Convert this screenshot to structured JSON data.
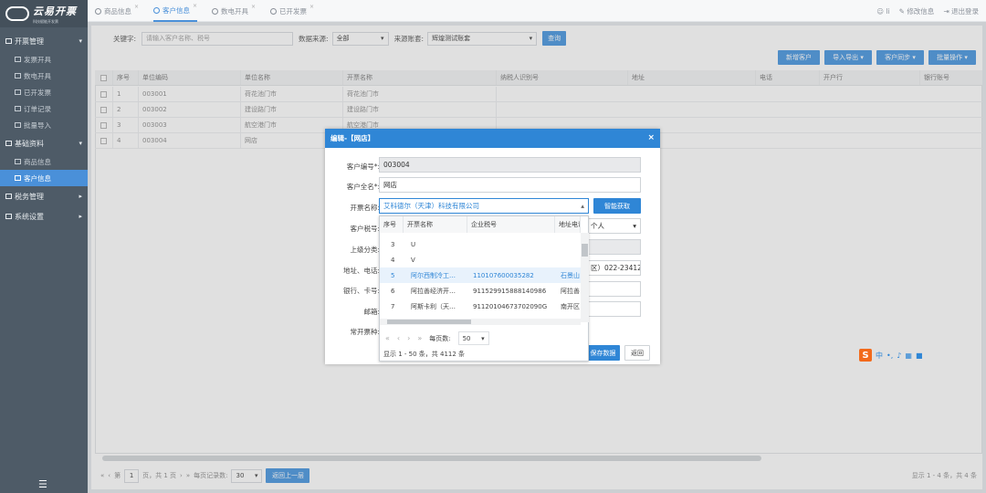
{
  "app": {
    "logo_title": "云易开票",
    "logo_subtitle": "科技赋能开发票"
  },
  "sidebar": {
    "groups": [
      {
        "label": "开票管理",
        "items": [
          "发票开具",
          "数电开具",
          "已开发票",
          "订单记录",
          "批量导入"
        ]
      },
      {
        "label": "基础资料",
        "items": [
          "商品信息",
          "客户信息"
        ]
      },
      {
        "label": "税务管理",
        "items": []
      },
      {
        "label": "系统设置",
        "items": []
      }
    ],
    "active_item": "客户信息"
  },
  "tabs": [
    {
      "label": "商品信息"
    },
    {
      "label": "客户信息"
    },
    {
      "label": "数电开具"
    },
    {
      "label": "已开发票"
    }
  ],
  "header": {
    "user": "li",
    "change_info": "修改信息",
    "logout": "退出登录"
  },
  "search": {
    "keyword_label": "关键字:",
    "keyword_placeholder": "请输入客户名称、税号",
    "source_label": "数据来源:",
    "source_value": "全部",
    "account_label": "来源账套:",
    "account_value": "辉煌测试账套",
    "query_button": "查询"
  },
  "toolbar": {
    "add": "新增客户",
    "import_export": "导入导出 ▾",
    "sync": "客户同步 ▾",
    "batch": "批量操作 ▾"
  },
  "table": {
    "headers": [
      "序号",
      "单位编码",
      "单位名称",
      "开票名称",
      "纳税人识别号",
      "地址",
      "电话",
      "开户行",
      "银行账号"
    ],
    "rows": [
      [
        "1",
        "003001",
        "荷花池门市",
        "荷花池门市"
      ],
      [
        "2",
        "003002",
        "建设路门市",
        "建设路门市"
      ],
      [
        "3",
        "003003",
        "航空港门市",
        "航空港门市"
      ],
      [
        "4",
        "003004",
        "网店",
        ""
      ]
    ]
  },
  "pager": {
    "page_prefix": "第",
    "page": "1",
    "page_suffix": "页，共 1 页",
    "per_page_label": "每页记录数:",
    "per_page": "30",
    "back_button": "返回上一层",
    "summary": "显示 1 - 4 条，共 4 条"
  },
  "dialog": {
    "title": "编辑-【网店】",
    "labels": {
      "code": "客户编号*:",
      "fullname": "客户全名*:",
      "invoice_name": "开票名称:",
      "tax_no": "客户税号:",
      "parent": "上级分类:",
      "address": "地址、电话:",
      "bank": "银行、卡号:",
      "email": "邮箱:",
      "common_type": "常开票种:"
    },
    "values": {
      "code": "003004",
      "fullname": "网店",
      "invoice_name": "艾科德尔（天津）科技有限公司",
      "tax_type": "个人",
      "address_tail": "区）022-23412"
    },
    "smart_button": "智能获取",
    "save_button": "保存数据",
    "back_button": "返回"
  },
  "dropdown": {
    "headers": [
      "序号",
      "开票名称",
      "企业税号",
      "地址电话"
    ],
    "rows": [
      {
        "no": "3",
        "name": "U",
        "tax": "",
        "addr": ""
      },
      {
        "no": "4",
        "name": "V",
        "tax": "",
        "addr": ""
      },
      {
        "no": "5",
        "name": "阿尔西制冷工…",
        "tax": "110107600035282",
        "addr": "石景山"
      },
      {
        "no": "6",
        "name": "阿拉善经济开…",
        "tax": "911529915888140986",
        "addr": "阿拉善"
      },
      {
        "no": "7",
        "name": "阿斯卡利（天…",
        "tax": "91120104673702090G",
        "addr": "南开区"
      }
    ],
    "selected_no": "5",
    "per_page_label": "每页数:",
    "per_page": "50",
    "summary": "显示 1 - 50 条，共 4112 条"
  },
  "ime": {
    "logo": "S",
    "lang": "中"
  },
  "colors": {
    "primary": "#2f86d6",
    "sidebar": "#4e5b67",
    "active": "#4a90d9"
  }
}
